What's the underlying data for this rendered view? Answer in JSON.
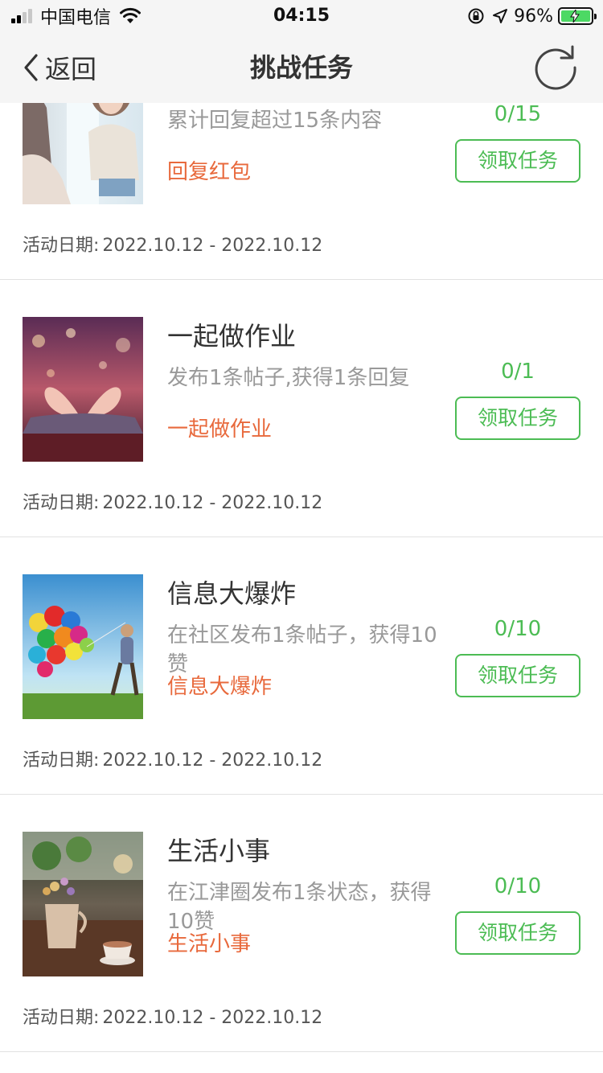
{
  "status_bar": {
    "carrier": "中国电信",
    "time": "04:15",
    "battery": "96%",
    "signal_bars": 2,
    "icons": [
      "signal-icon",
      "wifi-icon",
      "orientation-lock-icon",
      "location-arrow-icon",
      "battery-charging-icon"
    ]
  },
  "nav": {
    "back_label": "返回",
    "title": "挑战任务",
    "refresh_icon": "refresh-icon"
  },
  "colors": {
    "accent_green": "#4cbc54",
    "tag_orange": "#e8693c",
    "nav_bg": "#f5f5f5"
  },
  "tasks": [
    {
      "title": "",
      "desc": "累计回复超过15条内容",
      "tag": "回复红包",
      "progress": "0/15",
      "button": "领取任务",
      "date_label": "活动日期:",
      "date_range": "2022.10.12 - 2022.10.12",
      "image": "photo-woman-by-window"
    },
    {
      "title": "一起做作业",
      "desc": "发布1条帖子,获得1条回复",
      "tag": "一起做作业",
      "progress": "0/1",
      "button": "领取任务",
      "date_label": "活动日期:",
      "date_range": "2022.10.12 - 2022.10.12",
      "image": "photo-heart-book"
    },
    {
      "title": "信息大爆炸",
      "desc": "在社区发布1条帖子，获得10赞",
      "tag": "信息大爆炸",
      "progress": "0/10",
      "button": "领取任务",
      "date_label": "活动日期:",
      "date_range": "2022.10.12 - 2022.10.12",
      "image": "photo-balloons"
    },
    {
      "title": "生活小事",
      "desc": "在江津圈发布1条状态，获得10赞",
      "tag": "生活小事",
      "progress": "0/10",
      "button": "领取任务",
      "date_label": "活动日期:",
      "date_range": "2022.10.12 - 2022.10.12",
      "image": "photo-flowers-teacup"
    }
  ]
}
